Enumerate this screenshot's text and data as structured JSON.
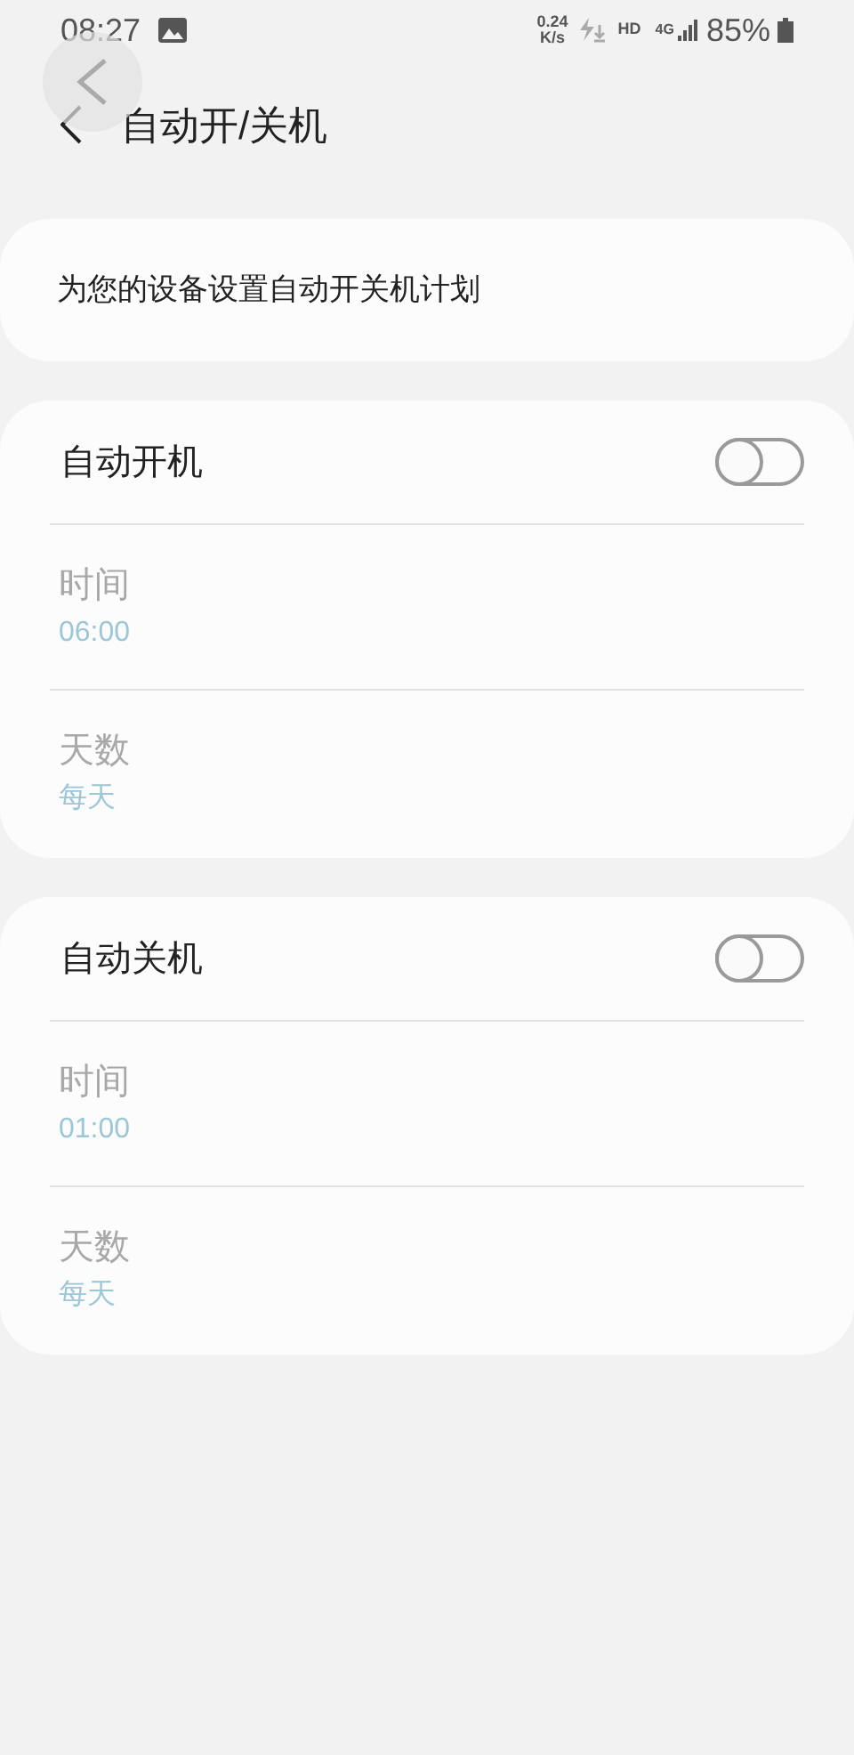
{
  "status_bar": {
    "time": "08:27",
    "speed": "0.24",
    "speed_unit": "K/s",
    "hd": "HD",
    "network": "4G",
    "battery": "85%"
  },
  "header": {
    "title": "自动开/关机"
  },
  "description": "为您的设备设置自动开关机计划",
  "sections": [
    {
      "title": "自动开机",
      "on": false,
      "rows": [
        {
          "label": "时间",
          "value": "06:00",
          "disabled": true
        },
        {
          "label": "天数",
          "value": "每天",
          "disabled": true
        }
      ]
    },
    {
      "title": "自动关机",
      "on": false,
      "rows": [
        {
          "label": "时间",
          "value": "01:00",
          "disabled": true
        },
        {
          "label": "天数",
          "value": "每天",
          "disabled": true
        }
      ]
    }
  ]
}
